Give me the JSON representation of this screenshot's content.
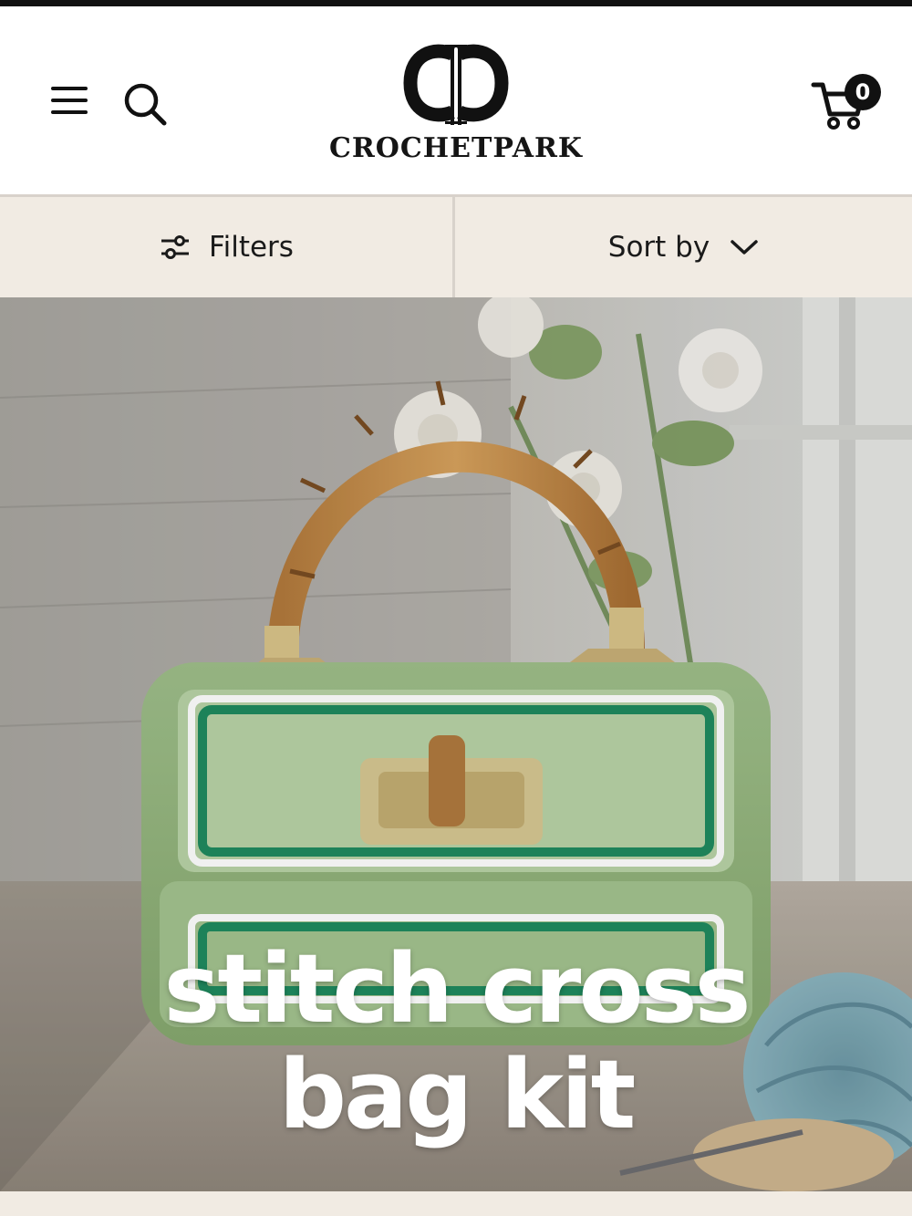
{
  "brand": {
    "name": "CROCHETPARK",
    "logo_icon": "cc-monogram-logo"
  },
  "header": {
    "menu_icon": "hamburger-menu-icon",
    "search_icon": "search-icon",
    "cart_icon": "shopping-cart-icon",
    "cart_count": "0"
  },
  "toolbar": {
    "filters_label": "Filters",
    "filters_icon": "sliders-icon",
    "sort_label": "Sort by",
    "sort_icon": "chevron-down-icon"
  },
  "hero": {
    "title": "stitch cross bag kit"
  },
  "colors": {
    "bar_bg": "#f1ebe3",
    "header_bg": "#ffffff",
    "text": "#111111"
  }
}
